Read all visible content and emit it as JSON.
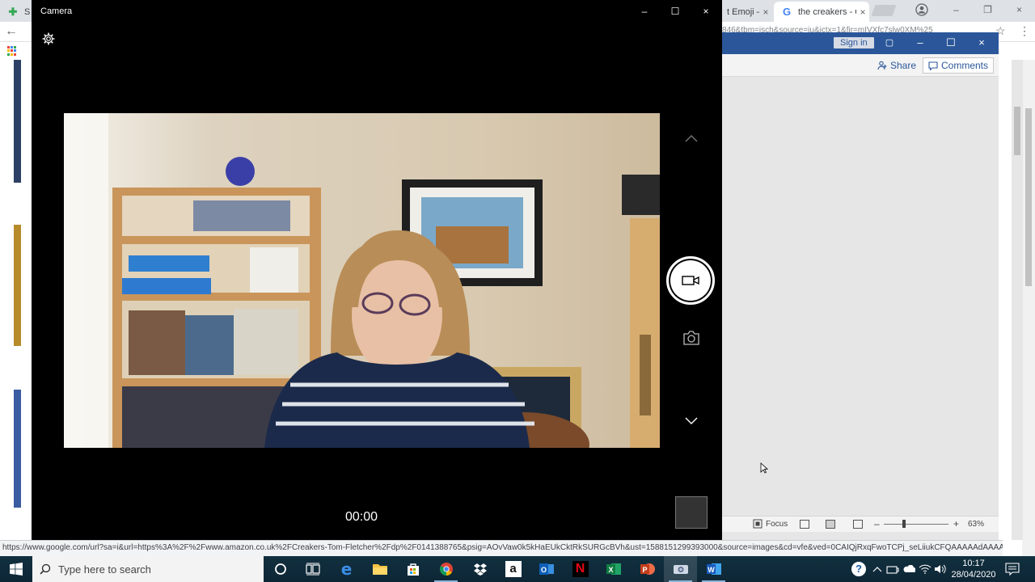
{
  "chrome": {
    "tabs": [
      {
        "title": "S",
        "state": "inactive"
      },
      {
        "title": "t Emoji –",
        "state": "inactive"
      },
      {
        "title": "the creakers - C",
        "state": "active"
      }
    ],
    "close_glyph": "×",
    "window_buttons": [
      "–",
      "❐",
      "×"
    ],
    "url_fragment": "846&tbm=isch&source=iu&ictx=1&fir=mIVXfc7slw0XM%25",
    "status_url": "https://www.google.com/url?sa=i&url=https%3A%2F%2Fwww.amazon.co.uk%2FCreakers-Tom-Fletcher%2Fdp%2F0141388765&psig=AOvVaw0k5kHaEUkCktRkSURGcBVh&ust=1588151299393000&source=images&cd=vfe&ved=0CAIQjRxqFwoTCPj_seLiiukCFQAAAAAdAAAAABAH"
  },
  "word": {
    "signin_label": "Sign in",
    "share_label": "Share",
    "comments_label": "Comments",
    "focus_label": "Focus",
    "zoom_level": "63%",
    "zoom_minus": "–",
    "zoom_plus": "+",
    "window_buttons": [
      "▢",
      "–",
      "☐",
      "×"
    ]
  },
  "camera": {
    "title": "Camera",
    "timer": "00:00",
    "window_buttons": [
      "–",
      "☐",
      "×"
    ]
  },
  "taskbar": {
    "search_placeholder": "Type here to search",
    "apps": [
      "cortana",
      "task-view",
      "edge",
      "file-explorer",
      "store",
      "chrome",
      "dropbox",
      "amazon",
      "outlook",
      "netflix",
      "excel",
      "powerpoint",
      "camera",
      "word"
    ],
    "time": "10:17",
    "date": "28/04/2020"
  },
  "colors": {
    "word_blue": "#2b579a",
    "camera_bg": "#000000",
    "taskbar": "#0f2a3b"
  }
}
